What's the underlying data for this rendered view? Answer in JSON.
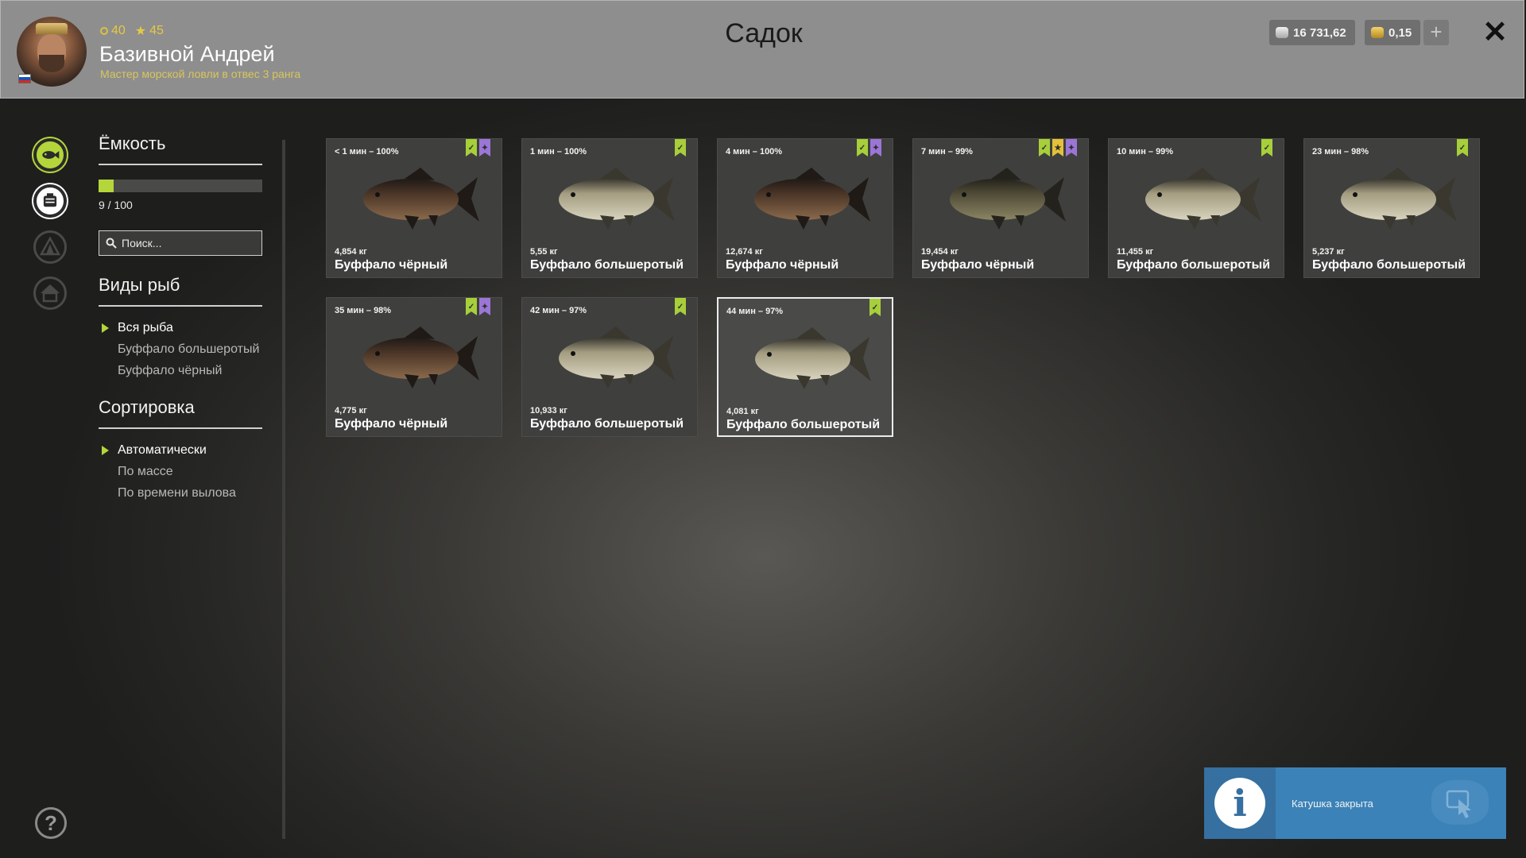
{
  "header": {
    "title": "Садок",
    "player": {
      "name": "Базивной Андрей",
      "rank": "Мастер морской ловли в отвес 3 ранга",
      "level": "40",
      "stars": "45",
      "flag": "russian-flag"
    },
    "currency": {
      "silver": "16 731,62",
      "gold": "0,15",
      "add_label": "+"
    },
    "close_label": "✕"
  },
  "nav": {
    "items": [
      {
        "icon": "fish-icon",
        "active": true
      },
      {
        "icon": "keepnet-icon",
        "active": true
      },
      {
        "icon": "tent-icon",
        "active": false
      },
      {
        "icon": "home-icon",
        "active": false
      }
    ],
    "help_label": "?"
  },
  "filters": {
    "capacity": {
      "title": "Ёмкость",
      "text": "9 / 100",
      "fill_fraction": 0.09
    },
    "search": {
      "placeholder": "Поиск..."
    },
    "species": {
      "title": "Виды рыб",
      "items": [
        "Вся рыба",
        "Буффало большеротый",
        "Буффало чёрный"
      ],
      "active_index": 0
    },
    "sort": {
      "title": "Сортировка",
      "items": [
        "Автоматически",
        "По массе",
        "По времени вылова"
      ],
      "active_index": 0
    }
  },
  "fish": [
    {
      "time": "< 1 мин – 100%",
      "weight": "4,854 кг",
      "name": "Буффало чёрный",
      "type": "black",
      "badges": [
        "green",
        "purple"
      ]
    },
    {
      "time": "1 мин – 100%",
      "weight": "5,55 кг",
      "name": "Буффало большеротый",
      "type": "bigmouth",
      "badges": [
        "green"
      ]
    },
    {
      "time": "4 мин – 100%",
      "weight": "12,674 кг",
      "name": "Буффало чёрный",
      "type": "black",
      "badges": [
        "green",
        "purple"
      ]
    },
    {
      "time": "7 мин – 99%",
      "weight": "19,454 кг",
      "name": "Буффало чёрный",
      "type": "black-olive",
      "badges": [
        "green",
        "gold",
        "purple"
      ]
    },
    {
      "time": "10 мин – 99%",
      "weight": "11,455 кг",
      "name": "Буффало большеротый",
      "type": "bigmouth",
      "badges": [
        "green"
      ]
    },
    {
      "time": "23 мин – 98%",
      "weight": "5,237 кг",
      "name": "Буффало большеротый",
      "type": "bigmouth",
      "badges": [
        "green"
      ]
    },
    {
      "time": "35 мин – 98%",
      "weight": "4,775 кг",
      "name": "Буффало чёрный",
      "type": "black",
      "badges": [
        "green",
        "purple"
      ]
    },
    {
      "time": "42 мин – 97%",
      "weight": "10,933 кг",
      "name": "Буффало большеротый",
      "type": "bigmouth",
      "badges": [
        "green"
      ]
    },
    {
      "time": "44 мин – 97%",
      "weight": "4,081 кг",
      "name": "Буффало большеротый",
      "type": "bigmouth",
      "badges": [
        "green"
      ],
      "selected": true
    }
  ],
  "notification": {
    "text": "Катушка закрыта",
    "icon": "info-icon"
  },
  "colors": {
    "accent_green": "#b4d63b",
    "badge_purple": "#9b76d6",
    "badge_gold": "#e3c23a",
    "toast_blue": "#3b82b8"
  }
}
